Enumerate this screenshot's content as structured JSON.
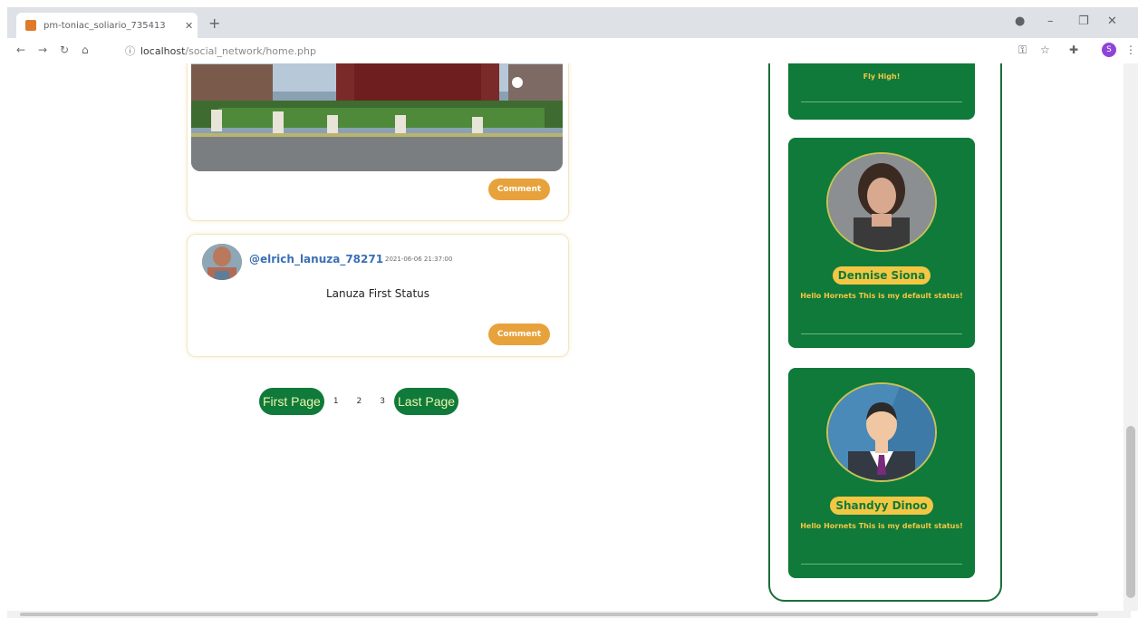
{
  "browser": {
    "tab_title": "pm-toniac_soliario_735413",
    "url_host": "localhost",
    "url_path": "/social_network/home.php",
    "profile_initial": "S"
  },
  "posts": [
    {
      "image": "street-photo",
      "comment_label": "Comment"
    },
    {
      "username": "@elrich_lanuza_78271",
      "timestamp": "2021-06-06 21:37:00",
      "status": "Lanuza First Status",
      "comment_label": "Comment"
    }
  ],
  "pagination": {
    "first": "First Page",
    "pages": [
      "1",
      "2",
      "3"
    ],
    "last": "Last Page"
  },
  "sidebar": {
    "cards": [
      {
        "name": "",
        "status": "Fly High!"
      },
      {
        "name": "Dennise Siona",
        "status": "Hello Hornets This is my default status!"
      },
      {
        "name": "Shandyy Dinoo",
        "status": "Hello Hornets This is my default status!"
      }
    ]
  },
  "colors": {
    "green": "#0f7a3a",
    "gold": "#f3c743",
    "comment": "#e8a23c"
  }
}
